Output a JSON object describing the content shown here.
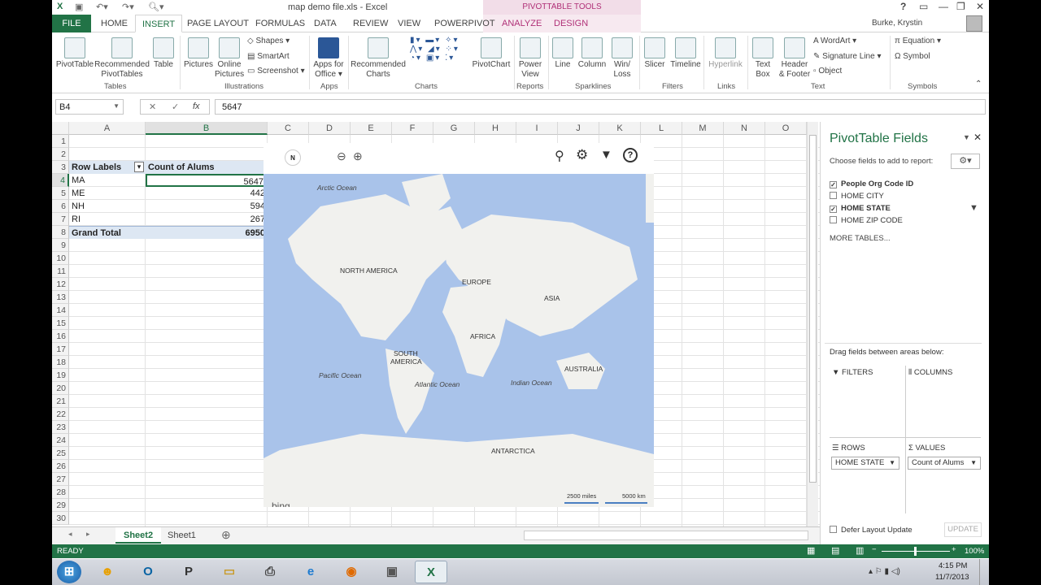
{
  "window": {
    "title": "map demo file.xls - Excel",
    "context_group": "PIVOTTABLE TOOLS",
    "user": "Burke, Krystin",
    "help": "?"
  },
  "tabs": [
    "FILE",
    "HOME",
    "INSERT",
    "PAGE LAYOUT",
    "FORMULAS",
    "DATA",
    "REVIEW",
    "VIEW",
    "POWERPIVOT",
    "ANALYZE",
    "DESIGN"
  ],
  "ribbon": {
    "tables": {
      "group": "Tables",
      "pivottable": "PivotTable",
      "recommended": "Recommended",
      "recommended2": "PivotTables",
      "table": "Table"
    },
    "illustrations": {
      "group": "Illustrations",
      "pictures": "Pictures",
      "online": "Online",
      "online2": "Pictures",
      "shapes": "Shapes",
      "smartart": "SmartArt",
      "screenshot": "Screenshot"
    },
    "apps": {
      "group": "Apps",
      "apps_for": "Apps for",
      "office": "Office"
    },
    "charts": {
      "group": "Charts",
      "recommended": "Recommended",
      "charts": "Charts",
      "pivotchart": "PivotChart"
    },
    "reports": {
      "group": "Reports",
      "power": "Power",
      "view": "View"
    },
    "sparklines": {
      "group": "Sparklines",
      "line": "Line",
      "column": "Column",
      "winloss": "Win/",
      "loss": "Loss"
    },
    "filters": {
      "group": "Filters",
      "slicer": "Slicer",
      "timeline": "Timeline"
    },
    "links": {
      "group": "Links",
      "hyperlink": "Hyperlink"
    },
    "text": {
      "group": "Text",
      "textbox": "Text",
      "box": "Box",
      "header": "Header",
      "footer": "& Footer",
      "wordart": "WordArt",
      "signature": "Signature Line",
      "object": "Object"
    },
    "symbols": {
      "group": "Symbols",
      "equation": "Equation",
      "symbol": "Symbol"
    }
  },
  "formula_bar": {
    "name_box": "B4",
    "value": "5647",
    "fx": "fx"
  },
  "columns": [
    "A",
    "B",
    "C",
    "D",
    "E",
    "F",
    "G",
    "H",
    "I",
    "J",
    "K",
    "L",
    "M",
    "N",
    "O"
  ],
  "rows": [
    "1",
    "2",
    "3",
    "4",
    "5",
    "6",
    "7",
    "8",
    "9",
    "10",
    "11",
    "12",
    "13",
    "14",
    "15",
    "16",
    "17",
    "18",
    "19",
    "20",
    "21",
    "22",
    "23",
    "24",
    "25",
    "26",
    "27",
    "28",
    "29",
    "30"
  ],
  "pivot": {
    "header_label": "Row Labels",
    "header_value": "Count of Alums",
    "data": [
      {
        "label": "MA",
        "value": "5647"
      },
      {
        "label": "ME",
        "value": "442"
      },
      {
        "label": "NH",
        "value": "594"
      },
      {
        "label": "RI",
        "value": "267"
      }
    ],
    "total_label": "Grand Total",
    "total_value": "6950"
  },
  "map": {
    "labels": {
      "arctic": "Arctic Ocean",
      "na": "NORTH AMERICA",
      "europe": "EUROPE",
      "asia": "ASIA",
      "africa": "AFRICA",
      "sa1": "SOUTH",
      "sa2": "AMERICA",
      "pacific": "Pacific Ocean",
      "atlantic": "Atlantic Ocean",
      "indian": "Indian Ocean",
      "australia": "AUSTRALIA",
      "antarctica": "ANTARCTICA"
    },
    "scale_miles": "2500 miles",
    "scale_km": "5000 km",
    "brand": "bing",
    "compass": "N"
  },
  "pane": {
    "title": "PivotTable Fields",
    "choose": "Choose fields to add to report:",
    "fields": [
      {
        "name": "People Org Code ID",
        "checked": true
      },
      {
        "name": "HOME CITY",
        "checked": false
      },
      {
        "name": "HOME STATE",
        "checked": true
      },
      {
        "name": "HOME ZIP CODE",
        "checked": false
      }
    ],
    "more_tables": "MORE TABLES...",
    "drag": "Drag fields between areas below:",
    "filters": "FILTERS",
    "columns": "COLUMNS",
    "rows": "ROWS",
    "values": "VALUES",
    "rows_chip": "HOME STATE",
    "values_chip": "Count of Alums",
    "defer": "Defer Layout Update",
    "update": "UPDATE"
  },
  "sheets": {
    "active": "Sheet2",
    "other": "Sheet1"
  },
  "status": {
    "ready": "READY",
    "zoom": "100%"
  },
  "taskbar": {
    "time": "4:15 PM",
    "date": "11/7/2013"
  },
  "colors": {
    "excel_green": "#217346",
    "pivot_pink": "#b03077",
    "sea": "#a9c3ea"
  }
}
